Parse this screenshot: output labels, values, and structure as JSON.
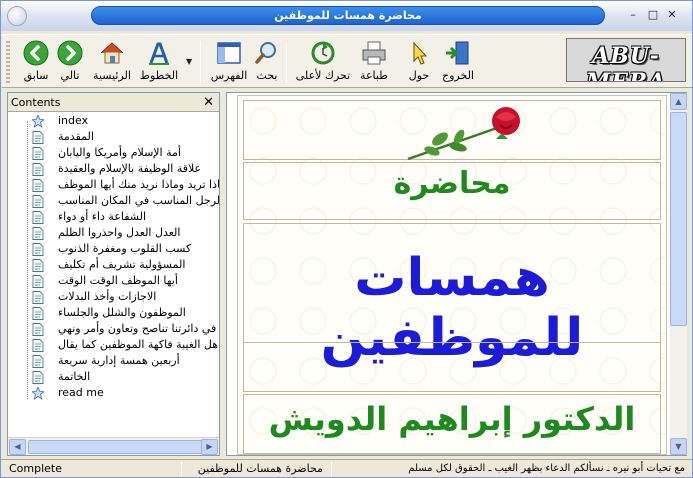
{
  "window": {
    "title": "محاضرة همسات للموظفين",
    "controls": {
      "minimize": "–",
      "maximize": "□",
      "close": "✕"
    }
  },
  "toolbar": {
    "back": "سابق",
    "next": "تالي",
    "home": "الرئيسية",
    "fonts": "الخطوط",
    "index": "الفهرس",
    "search": "بحث",
    "top": "تحرك لأعلى",
    "print": "طباعة",
    "about": "حول",
    "exit": "الخروج",
    "logo": "ABU-MERA"
  },
  "contents": {
    "header": "Contents",
    "close": "✕",
    "items": [
      {
        "label": "index",
        "icon": "star-icon"
      },
      {
        "label": "المقدمة",
        "icon": "page-icon"
      },
      {
        "label": "أمة الإسلام وأمريكا واليابان",
        "icon": "page-icon"
      },
      {
        "label": "علاقة الوظيفة بالإسلام والعقيدة",
        "icon": "page-icon"
      },
      {
        "label": "ماذا تريد وماذا نريد منك أيها الموظف",
        "icon": "page-icon"
      },
      {
        "label": "الرجل المناسب في المكان المناسب",
        "icon": "page-icon"
      },
      {
        "label": "الشفاعة داء أو دواء",
        "icon": "page-icon"
      },
      {
        "label": "العدل العدل واحذروا الظلم",
        "icon": "page-icon"
      },
      {
        "label": "كسب القلوب ومغفرة الذنوب",
        "icon": "page-icon"
      },
      {
        "label": "المسؤولية تشريف أم تكليف",
        "icon": "page-icon"
      },
      {
        "label": "أيها الموظف الوقت الوقت",
        "icon": "page-icon"
      },
      {
        "label": "الاجازات وأخذ البدلات",
        "icon": "page-icon"
      },
      {
        "label": "الموظفون والشلل والجلساء",
        "icon": "page-icon"
      },
      {
        "label": "في دائرتنا تناصح وتعاون وأمر ونهي",
        "icon": "page-icon"
      },
      {
        "label": "هل الغيبة فاكهة الموظفين كما يقال",
        "icon": "page-icon"
      },
      {
        "label": "أربعين همسة إدارية سريعة",
        "icon": "page-icon"
      },
      {
        "label": "الخاتمة",
        "icon": "page-icon"
      },
      {
        "label": "read me",
        "icon": "star-icon"
      }
    ]
  },
  "viewer": {
    "line1": "محاضرة",
    "line2": "همسات للموظفين",
    "line3": "الدكتور إبراهيم الدويش"
  },
  "status": {
    "left": "Complete",
    "middle": "محاضرة همسات للموظفين",
    "right": "مع تحيات أبو نيره ـ نسألكم الدعاء بظهر الغيب ـ الحقوق لكل مسلم"
  },
  "colors": {
    "title_green": "#1c8a1c",
    "title_blue": "#1b1bd8",
    "xp_blue": "#1d63d0"
  }
}
